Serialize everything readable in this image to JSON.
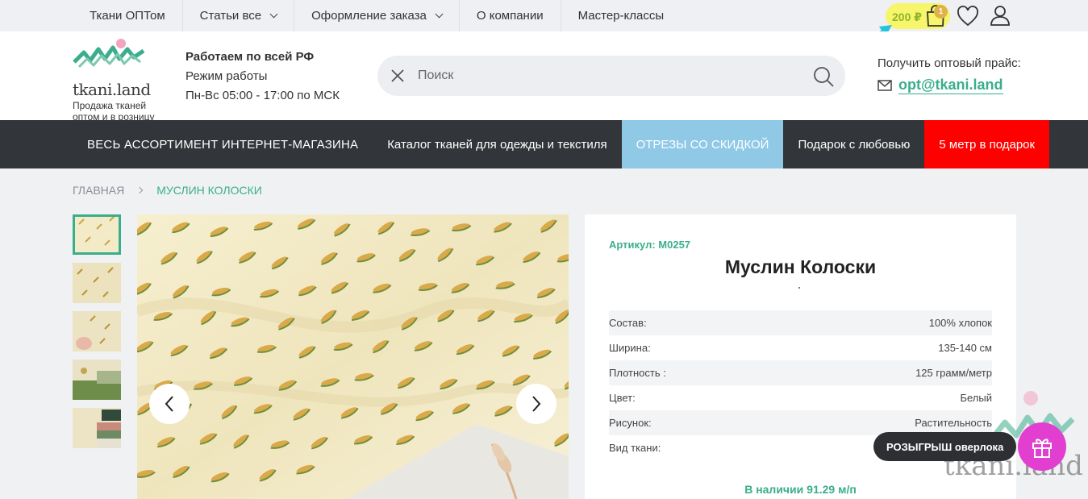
{
  "topnav": {
    "items": [
      {
        "label": "Ткани ОПТом",
        "dropdown": false
      },
      {
        "label": "Статьи все",
        "dropdown": true
      },
      {
        "label": "Оформление заказа",
        "dropdown": true
      },
      {
        "label": "О компании",
        "dropdown": false
      },
      {
        "label": "Мастер-классы",
        "dropdown": false
      }
    ],
    "cart_total": "200 ₽",
    "cart_count": "1"
  },
  "header": {
    "logo_text": "tkani.land",
    "logo_tagline": "Продажа тканей оптом и в розницу",
    "work_title": "Работаем по всей РФ",
    "work_hours_label": "Режим работы",
    "work_hours": "Пн-Вс 05:00 - 17:00 по МСК",
    "search_placeholder": "Поиск",
    "price_caption": "Получить оптовый прайс:",
    "email": "opt@tkani.land"
  },
  "catbar": {
    "items": [
      "ВЕСЬ АССОРТИМЕНТ ИНТЕРНЕТ-МАГАЗИНА",
      "Каталог тканей для одежды и текстиля",
      "ОТРЕЗЫ СО СКИДКОЙ",
      "Подарок с любовью",
      "5 метр в подарок"
    ]
  },
  "breadcrumb": {
    "home": "ГЛАВНАЯ",
    "current": "МУСЛИН КОЛОСКИ"
  },
  "product": {
    "sku": "Артикул: М0257",
    "title": "Муслин Колоски",
    "specs": [
      {
        "label": "Состав:",
        "value": "100% хлопок"
      },
      {
        "label": "Ширина:",
        "value": "135-140 см"
      },
      {
        "label": "Плотность :",
        "value": "125 грамм/метр"
      },
      {
        "label": "Цвет:",
        "value": "Белый"
      },
      {
        "label": "Рисунок:",
        "value": "Растительность"
      },
      {
        "label": "Вид ткани:",
        "value": ""
      }
    ],
    "stock": "В наличии 91.29 м/п"
  },
  "promo": {
    "label": "РОЗЫГРЫШ оверлока",
    "watermark": "tkani.land"
  },
  "colors": {
    "accent": "#3aae8c",
    "dark_bar": "#323539",
    "sale": "#8fc9e6",
    "red": "#ff0000",
    "gift": "#e23fd0"
  }
}
